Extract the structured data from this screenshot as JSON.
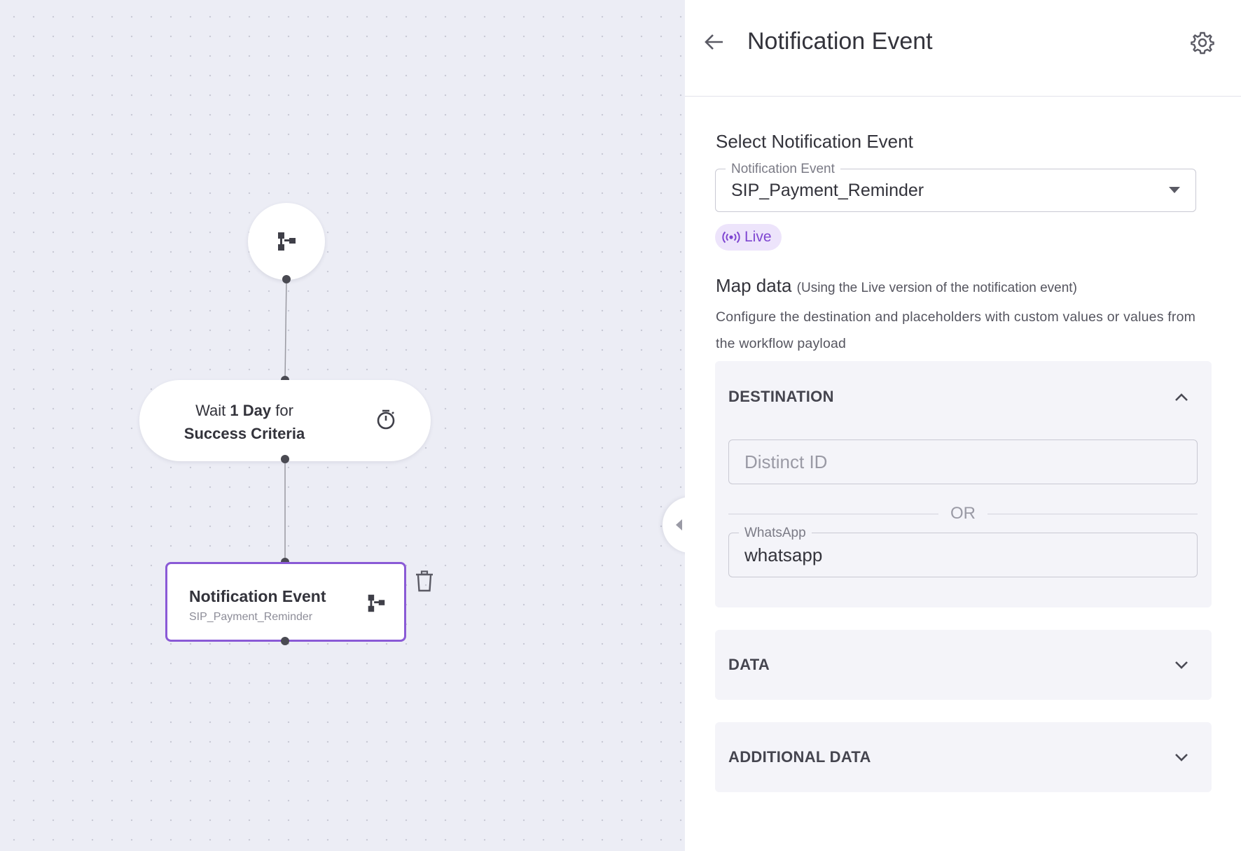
{
  "canvas": {
    "wait_node": {
      "prefix": "Wait",
      "duration": "1 Day",
      "middle": "for",
      "criteria": "Success Criteria"
    },
    "notification_node": {
      "title": "Notification Event",
      "subtitle": "SIP_Payment_Reminder"
    }
  },
  "panel": {
    "title": "Notification Event",
    "select_section_title": "Select Notification Event",
    "select_field": {
      "label": "Notification Event",
      "value": "SIP_Payment_Reminder"
    },
    "live_badge": "Live",
    "map_data": {
      "title": "Map data",
      "note": "(Using the Live version of the notification event)",
      "description": "Configure the destination and placeholders with custom values or values from the workflow payload"
    },
    "destination": {
      "header": "DESTINATION",
      "distinct_id_placeholder": "Distinct ID",
      "or_label": "OR",
      "whatsapp_label": "WhatsApp",
      "whatsapp_value": "whatsapp"
    },
    "data_section": {
      "header": "DATA"
    },
    "additional_data_section": {
      "header": "ADDITIONAL DATA"
    }
  },
  "colors": {
    "accent": "#8a5ad6",
    "live_text": "#7e45d1",
    "live_bg": "#ede4fb",
    "canvas_bg": "#ecedf5",
    "section_bg": "#f4f4f9"
  },
  "icons": [
    "workflow-icon",
    "timer-icon",
    "trash-icon",
    "back-arrow-icon",
    "gear-icon",
    "live-broadcast-icon",
    "chevron-up-icon",
    "chevron-down-icon",
    "resize-handle-icon"
  ]
}
